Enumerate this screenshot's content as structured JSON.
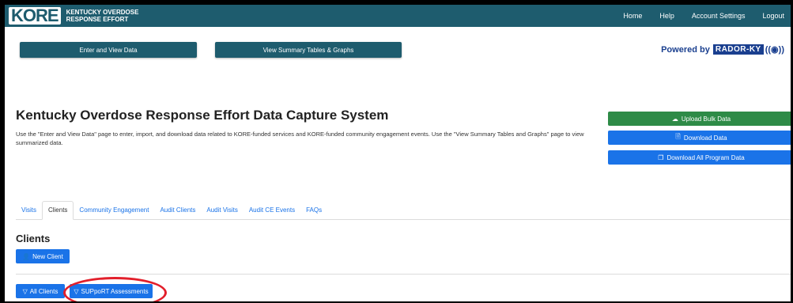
{
  "brand": {
    "logo_text": "KORE",
    "subtitle_line1": "KENTUCKY OVERDOSE",
    "subtitle_line2": "RESPONSE EFFORT",
    "primary_color": "#1e5c6e"
  },
  "topnav": {
    "links": [
      "Home",
      "Help",
      "Account Settings",
      "Logout"
    ]
  },
  "actionbar": {
    "enter_view_label": "Enter and View Data",
    "summary_label": "View Summary Tables & Graphs",
    "powered_by": "Powered by",
    "powered_brand": "RADOR-KY"
  },
  "header": {
    "title": "Kentucky Overdose Response Effort Data Capture System",
    "description": "Use the \"Enter and View Data\" page to enter, import, and download data related to KORE-funded services and KORE-funded community engagement events. Use the \"View Summary Tables and Graphs\" page to view summarized data."
  },
  "side_buttons": {
    "upload_label": "Upload Bulk Data",
    "download_label": "Download Data",
    "download_all_label": "Download All Program Data",
    "upload_color": "#2e8b47",
    "download_color": "#1a73e8"
  },
  "tabs": [
    {
      "label": "Visits",
      "active": false
    },
    {
      "label": "Clients",
      "active": true
    },
    {
      "label": "Community Engagement",
      "active": false
    },
    {
      "label": "Audit Clients",
      "active": false
    },
    {
      "label": "Audit Visits",
      "active": false
    },
    {
      "label": "Audit CE Events",
      "active": false
    },
    {
      "label": "FAQs",
      "active": false
    }
  ],
  "clients": {
    "title": "Clients",
    "new_client_label": "New Client",
    "filter_all_label": "All Clients",
    "filter_support_label": "SUPpoRT Assessments"
  },
  "icons": {
    "upload": "cloud-upload-icon",
    "download": "file-icon",
    "download_all": "copy-icon",
    "new_client": "add-user-icon",
    "filter": "filter-icon"
  },
  "annotation_color": "#e21f2b"
}
